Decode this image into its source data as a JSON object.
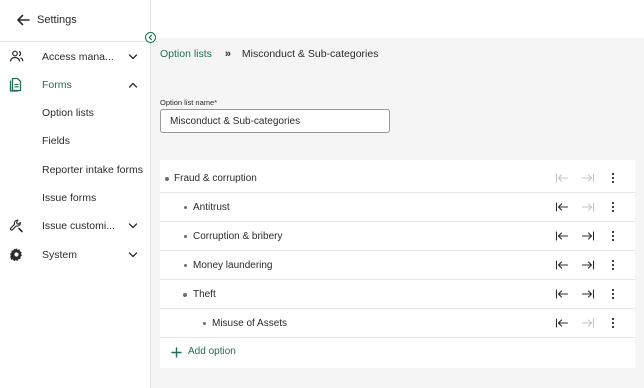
{
  "sidebar": {
    "title": "Settings",
    "items": [
      {
        "label": "Access mana...",
        "icon": "users-icon",
        "expanded": false
      },
      {
        "label": "Forms",
        "icon": "document-icon",
        "expanded": true
      },
      {
        "label": "Issue customi...",
        "icon": "wrench-icon",
        "expanded": false
      },
      {
        "label": "System",
        "icon": "gear-icon",
        "expanded": false
      }
    ],
    "forms_subitems": [
      "Option lists",
      "Fields",
      "Reporter intake forms",
      "Issue forms"
    ]
  },
  "breadcrumb": {
    "parent": "Option lists",
    "separator": "»",
    "current": "Misconduct & Sub-categories"
  },
  "form": {
    "name_label": "Option list name*",
    "name_value": "Misconduct & Sub-categories"
  },
  "options": [
    {
      "label": "Fraud & corruption",
      "level": 0,
      "outdent_enabled": false,
      "indent_enabled": false
    },
    {
      "label": "Antitrust",
      "level": 1,
      "outdent_enabled": true,
      "indent_enabled": false
    },
    {
      "label": "Corruption & bribery",
      "level": 1,
      "outdent_enabled": true,
      "indent_enabled": true
    },
    {
      "label": "Money laundering",
      "level": 1,
      "outdent_enabled": true,
      "indent_enabled": true
    },
    {
      "label": "Theft",
      "level": 1,
      "outdent_enabled": true,
      "indent_enabled": true
    },
    {
      "label": "Misuse of Assets",
      "level": 2,
      "outdent_enabled": true,
      "indent_enabled": false
    }
  ],
  "add_option_label": "Add option",
  "colors": {
    "accent": "#1f6e54",
    "text": "#2b2b2b",
    "disabled": "#c4c4c4",
    "background": "#f5f5f5"
  }
}
